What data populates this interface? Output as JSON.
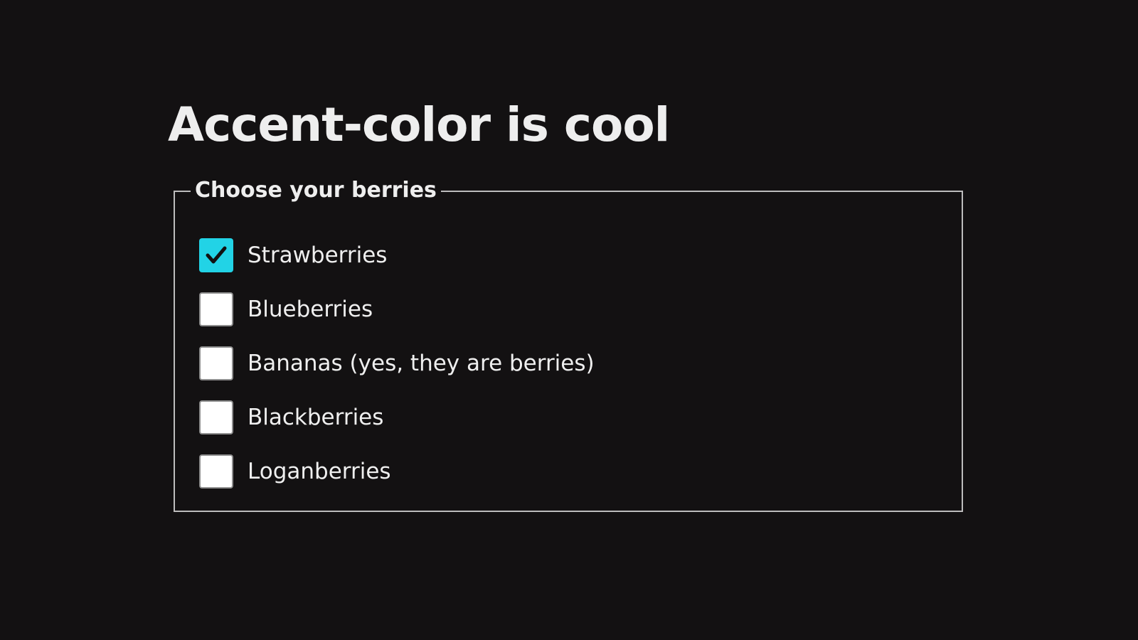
{
  "page": {
    "title": "Accent-color is cool"
  },
  "fieldset": {
    "legend": "Choose your berries",
    "options": [
      {
        "label": "Strawberries",
        "checked": true
      },
      {
        "label": "Blueberries",
        "checked": false
      },
      {
        "label": "Bananas (yes, they are berries)",
        "checked": false
      },
      {
        "label": "Blackberries",
        "checked": false
      },
      {
        "label": "Loganberries",
        "checked": false
      }
    ]
  },
  "colors": {
    "accent": "#22d3e6",
    "checkmark": "#111111",
    "background": "#131112",
    "text": "#eeeeee",
    "unchecked_box": "#ffffff",
    "fieldset_border": "#bdbdbd"
  },
  "icons": {
    "checked": "checkmark-icon"
  }
}
